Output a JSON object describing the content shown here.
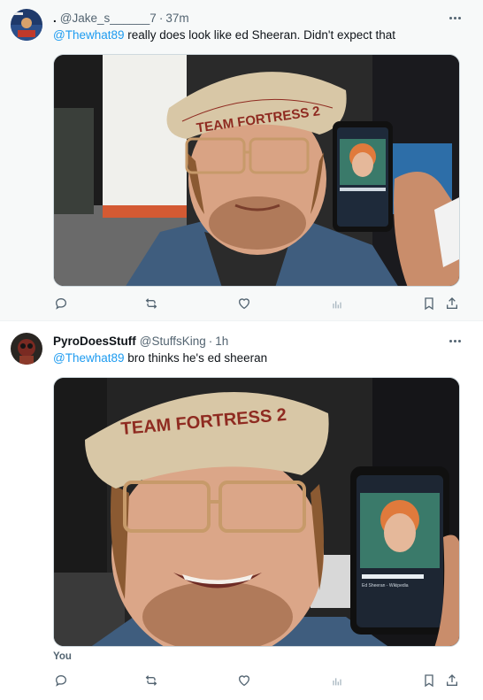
{
  "tweets": [
    {
      "display_name": ".",
      "handle": "@Jake_s______7",
      "time": "37m",
      "mention": "@Thewhat89",
      "text": " really does look like ed Sheeran. Didn't expect that",
      "media_caption": "TEAM FORTRESS 2",
      "phone_label": "Ed Sheeran - Wikipedia"
    },
    {
      "display_name": "PyroDoesStuff",
      "handle": "@StuffsKing",
      "time": "1h",
      "mention": "@Thewhat89",
      "text": " bro thinks he's ed sheeran",
      "media_caption": "TEAM FORTRESS 2",
      "phone_label": "Ed Sheeran - Wikipedia",
      "media_author_label": "You"
    }
  ],
  "icons": {
    "reply": "reply-icon",
    "retweet": "retweet-icon",
    "like": "heart-icon",
    "views": "views-icon",
    "bookmark": "bookmark-icon",
    "share": "share-icon",
    "more": "more-icon"
  },
  "colors": {
    "link": "#1d9bf0",
    "muted": "#536471",
    "highlight_bg": "#f7f9f9"
  }
}
